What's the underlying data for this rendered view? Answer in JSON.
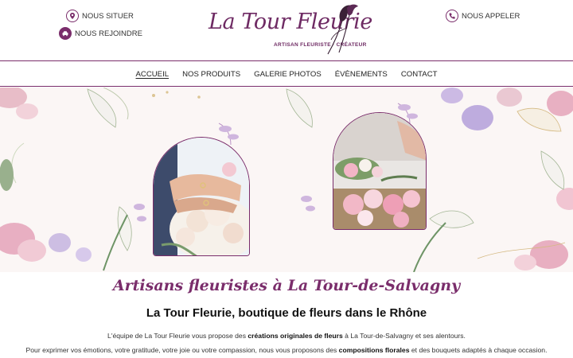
{
  "header": {
    "locate_label": "NOUS SITUER",
    "join_label": "NOUS REJOINDRE",
    "call_label": "NOUS APPELER",
    "logo_title": "La Tour Fleurie",
    "logo_subtitle": "ARTISAN FLEURISTE · CRÉATEUR"
  },
  "nav": {
    "items": [
      "ACCUEIL",
      "NOS PRODUITS",
      "GALERIE PHOTOS",
      "ÉVÈNEMENTS",
      "CONTACT"
    ],
    "active": "ACCUEIL"
  },
  "main": {
    "script_title": "Artisans fleuristes à La Tour-de-Salvagny",
    "title": "La Tour Fleurie, boutique de fleurs dans le Rhône",
    "p1": {
      "pre": "L'équipe de La Tour Fleurie vous propose des ",
      "bold": "créations originales de fleurs",
      "post": " à La Tour-de-Salvagny et ses alentours."
    },
    "p2": {
      "pre": "Pour exprimer vos émotions, votre gratitude, votre joie ou votre compassion, nous vous proposons des ",
      "bold": "compositions florales",
      "post": " et des bouquets adaptés à chaque occasion."
    }
  },
  "colors": {
    "brand": "#7a2d6b",
    "hero_bg": "#fbf6f5"
  },
  "icons": {
    "locate": "map-pin-icon",
    "join": "car-icon",
    "call": "phone-icon"
  }
}
